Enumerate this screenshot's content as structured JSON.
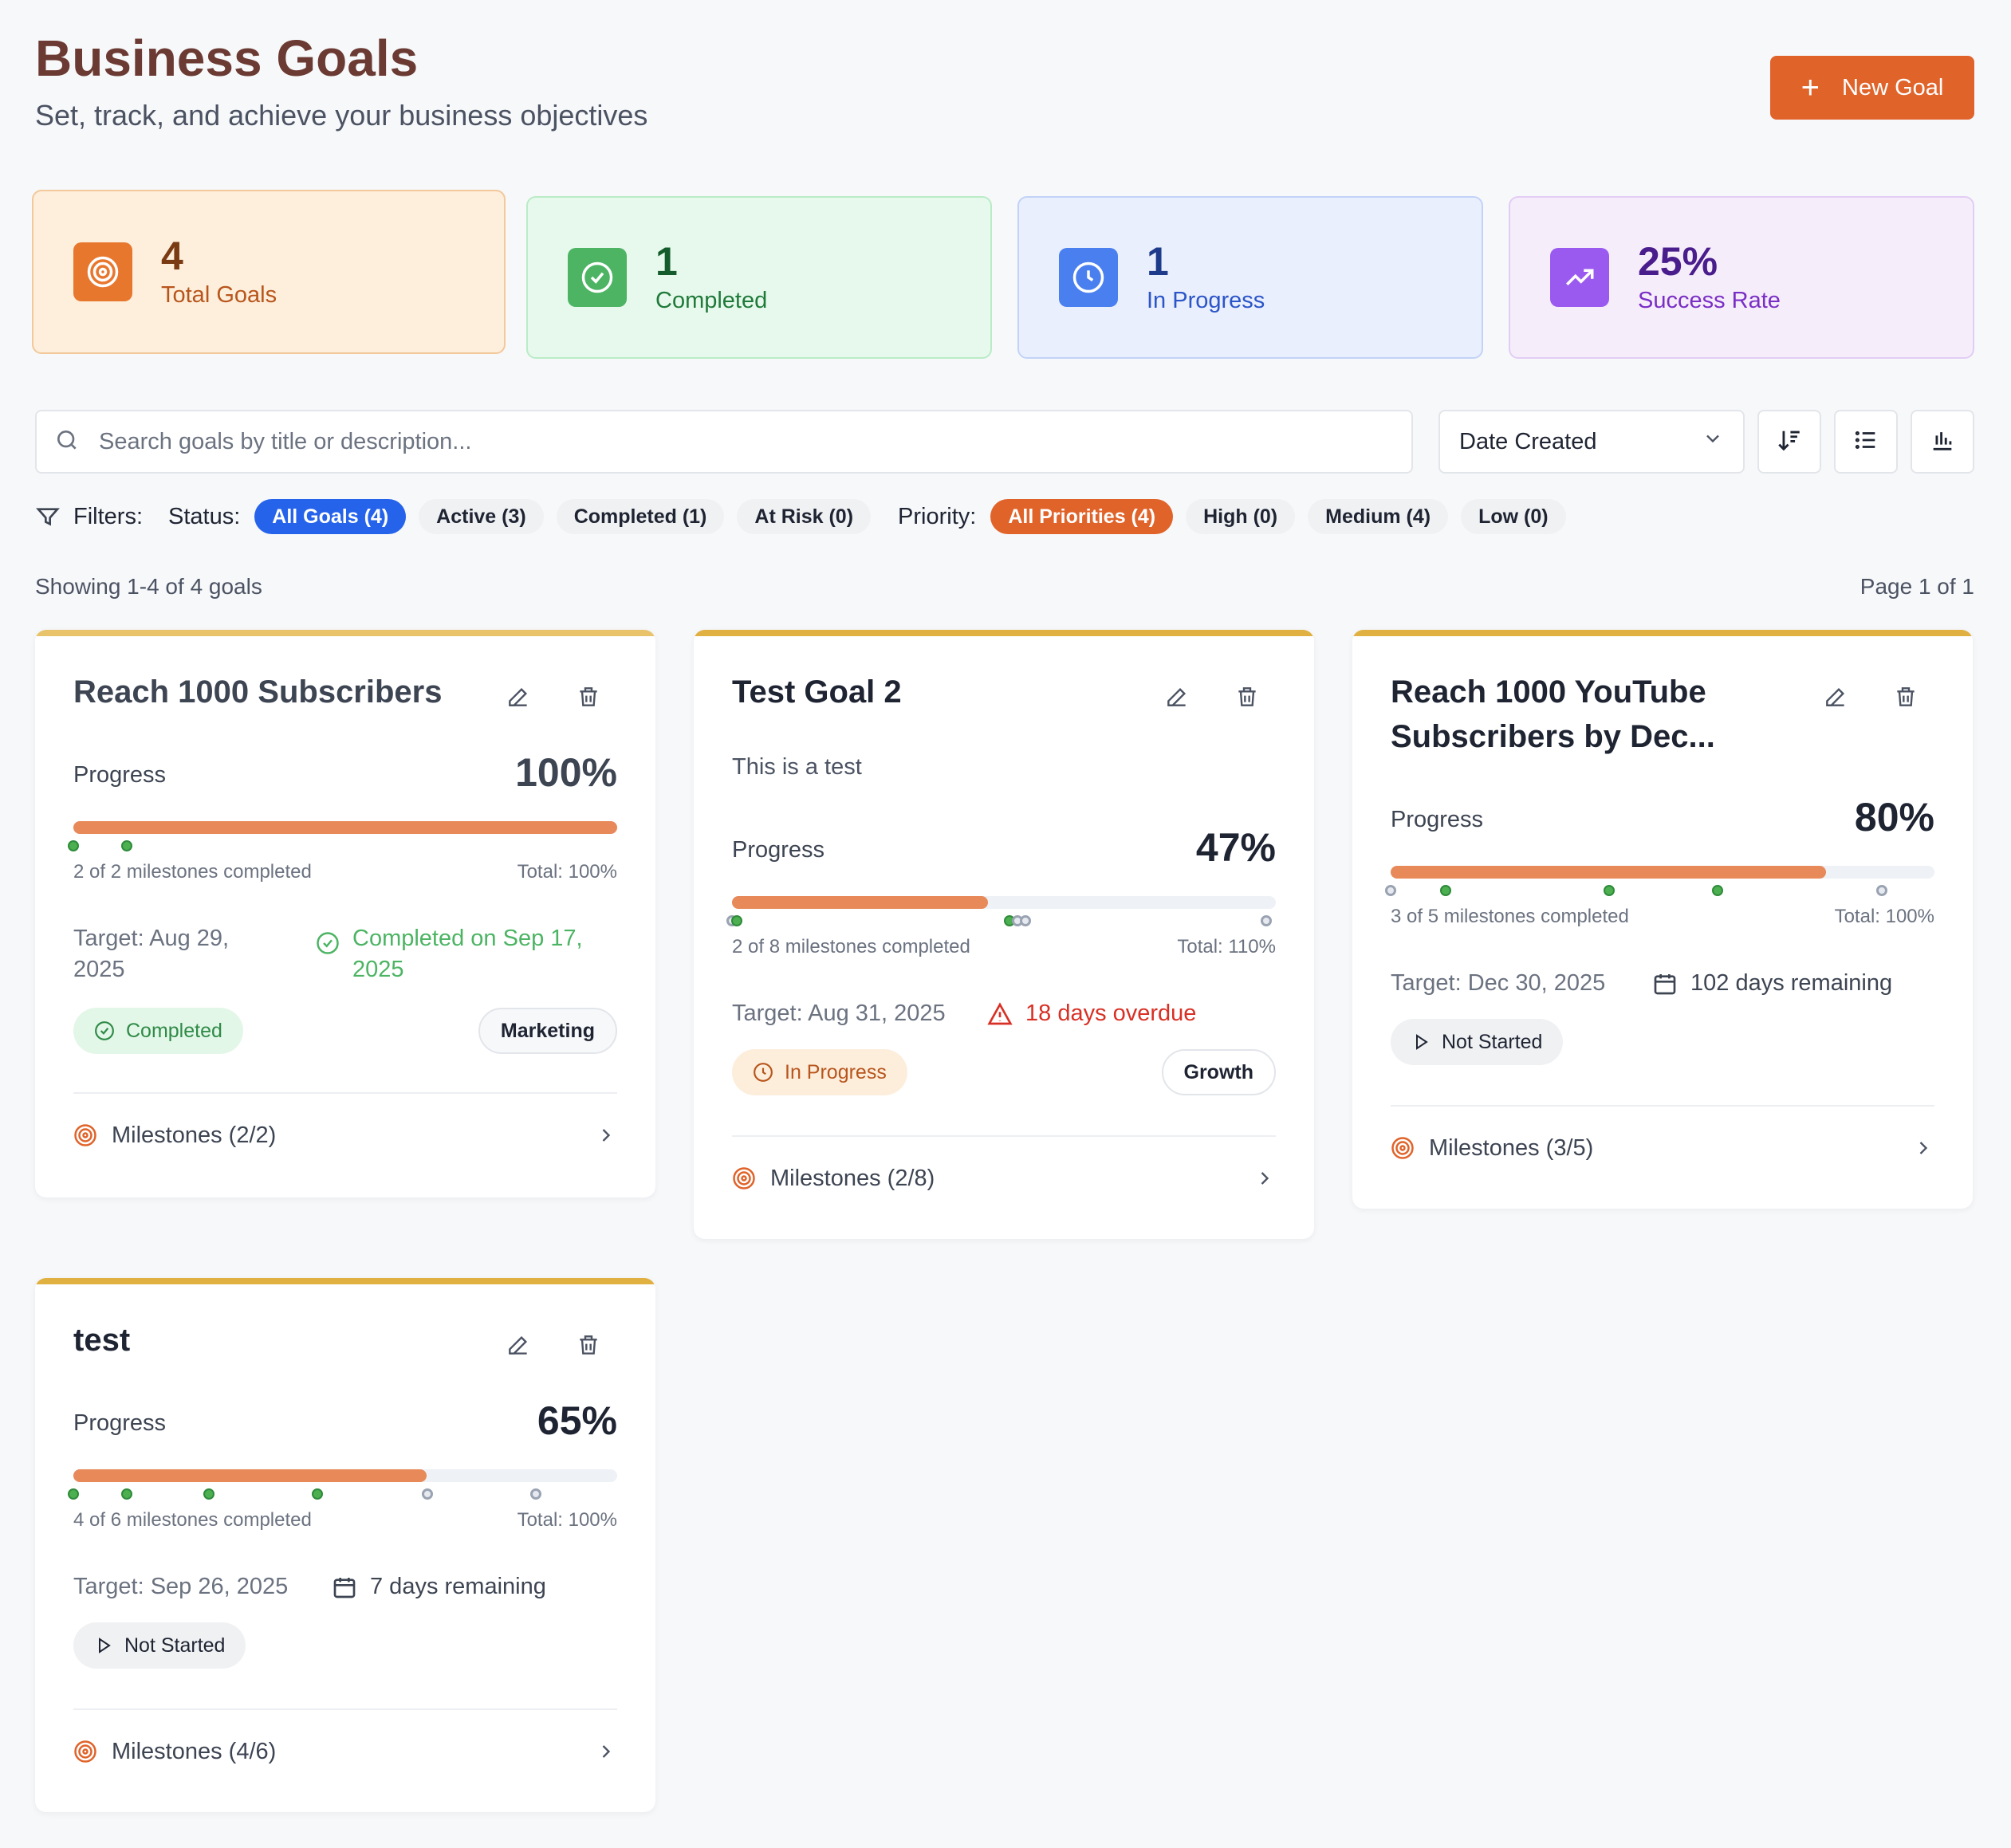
{
  "header": {
    "title": "Business Goals",
    "subtitle": "Set, track, and achieve your business objectives",
    "new_goal_label": "New Goal"
  },
  "stats": [
    {
      "value": "4",
      "label": "Total Goals",
      "icon": "target-icon",
      "color": "#e8772e"
    },
    {
      "value": "1",
      "label": "Completed",
      "icon": "check-circle-icon",
      "color": "#4cb463"
    },
    {
      "value": "1",
      "label": "In Progress",
      "icon": "clock-icon",
      "color": "#4a7ff0"
    },
    {
      "value": "25%",
      "label": "Success Rate",
      "icon": "trending-up-icon",
      "color": "#9a5af0"
    }
  ],
  "search": {
    "placeholder": "Search goals by title or description..."
  },
  "sort": {
    "selected": "Date Created"
  },
  "filters": {
    "label": "Filters:",
    "status_label": "Status:",
    "status_options": [
      "All Goals (4)",
      "Active (3)",
      "Completed (1)",
      "At Risk (0)"
    ],
    "priority_label": "Priority:",
    "priority_options": [
      "All Priorities (4)",
      "High (0)",
      "Medium (4)",
      "Low (0)"
    ]
  },
  "results": {
    "showing": "Showing 1-4 of 4 goals",
    "page": "Page 1 of 1"
  },
  "goals": [
    {
      "title": "Reach 1000 Subscribers",
      "description": "",
      "progress_label": "Progress",
      "progress": "100%",
      "progress_fraction": 1.0,
      "milestones_done": [
        "done",
        "done"
      ],
      "milestones_text": "2 of 2 milestones completed",
      "total_text": "Total: 100%",
      "target": "Target: Aug 29, 2025",
      "note": "Completed on Sep 17, 2025",
      "status": "Completed",
      "category": "Marketing",
      "milestones_link": "Milestones (2/2)"
    },
    {
      "title": "Test Goal 2",
      "description": "This is a test",
      "progress_label": "Progress",
      "progress": "47%",
      "progress_fraction": 0.47,
      "milestones_text": "2 of 8 milestones completed",
      "total_text": "Total: 110%",
      "target": "Target: Aug 31, 2025",
      "note": "18 days overdue",
      "status": "In Progress",
      "category": "Growth",
      "milestones_link": "Milestones (2/8)"
    },
    {
      "title": "Reach 1000 YouTube Subscribers by Dec...",
      "description": "",
      "progress_label": "Progress",
      "progress": "80%",
      "progress_fraction": 0.8,
      "milestones_text": "3 of 5 milestones completed",
      "total_text": "Total: 100%",
      "target": "Target: Dec 30, 2025",
      "note": "102 days remaining",
      "status": "Not Started",
      "category": "",
      "milestones_link": "Milestones (3/5)"
    },
    {
      "title": "test",
      "description": "",
      "progress_label": "Progress",
      "progress": "65%",
      "progress_fraction": 0.65,
      "milestones_text": "4 of 6 milestones completed",
      "total_text": "Total: 100%",
      "target": "Target: Sep 26, 2025",
      "note": "7 days remaining",
      "status": "Not Started",
      "category": "",
      "milestones_link": "Milestones (4/6)"
    }
  ],
  "colors": {
    "accent": "#e0632a",
    "blue": "#2563eb",
    "card_topbar": "#e0b040",
    "success": "#4cb463",
    "danger": "#d93025"
  }
}
